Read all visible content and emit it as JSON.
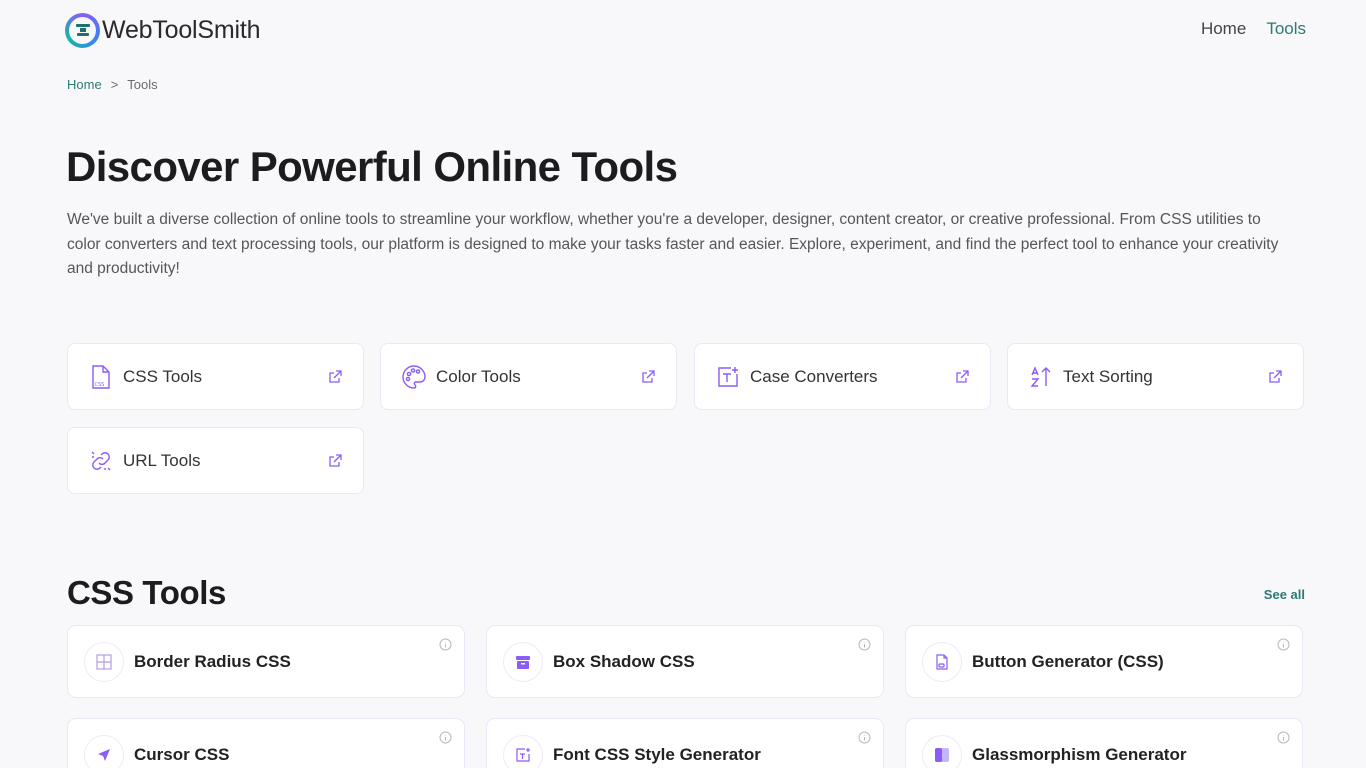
{
  "brand": {
    "name": "WebToolSmith",
    "accent": "#2c7a73",
    "icon_accent": "#8b5cf6"
  },
  "nav": {
    "home": "Home",
    "tools": "Tools"
  },
  "breadcrumb": {
    "home": "Home",
    "separator": ">",
    "current": "Tools"
  },
  "hero": {
    "title": "Discover Powerful Online Tools",
    "description": "We've built a diverse collection of online tools to streamline your workflow, whether you're a developer, designer, content creator, or creative professional. From CSS utilities to color converters and text processing tools, our platform is designed to make your tasks faster and easier. Explore, experiment, and find the perfect tool to enhance your creativity and productivity!"
  },
  "categories": [
    {
      "label": "CSS Tools",
      "icon": "css-file-icon"
    },
    {
      "label": "Color Tools",
      "icon": "palette-icon"
    },
    {
      "label": "Case Converters",
      "icon": "text-case-icon"
    },
    {
      "label": "Text Sorting",
      "icon": "sort-az-icon"
    },
    {
      "label": "URL Tools",
      "icon": "link-icon"
    }
  ],
  "css_section": {
    "title": "CSS Tools",
    "see_all": "See all",
    "tools": [
      {
        "label": "Border Radius CSS",
        "icon": "border-grid-icon"
      },
      {
        "label": "Box Shadow CSS",
        "icon": "archive-box-icon"
      },
      {
        "label": "Button Generator (CSS)",
        "icon": "file-button-icon"
      },
      {
        "label": "Cursor CSS",
        "icon": "cursor-arrow-icon"
      },
      {
        "label": "Font CSS Style Generator",
        "icon": "font-style-icon"
      },
      {
        "label": "Glassmorphism Generator",
        "icon": "glass-panel-icon"
      }
    ]
  }
}
